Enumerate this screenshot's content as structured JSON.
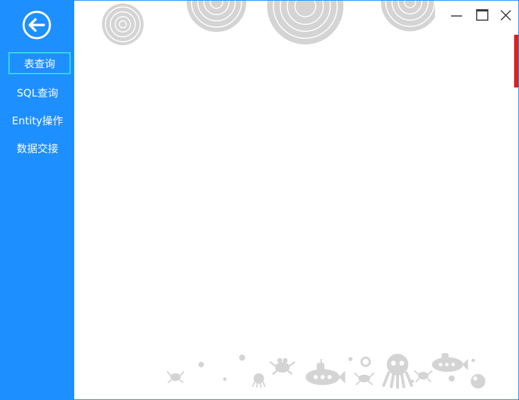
{
  "sidebar": {
    "back_icon": "arrow-left-circle-icon",
    "items": [
      {
        "label": "表查询",
        "active": true
      },
      {
        "label": "SQL查询",
        "active": false
      },
      {
        "label": "Entity操作",
        "active": false
      },
      {
        "label": "数据交接",
        "active": false
      }
    ]
  },
  "window_controls": {
    "minimize_icon": "minimize-icon",
    "maximize_icon": "maximize-icon",
    "close_icon": "close-icon"
  },
  "colors": {
    "sidebar_bg": "#1e8fff",
    "active_border": "#33d6e6",
    "scroll_thumb": "#e0201b",
    "decoration": "#d4d4d4"
  }
}
